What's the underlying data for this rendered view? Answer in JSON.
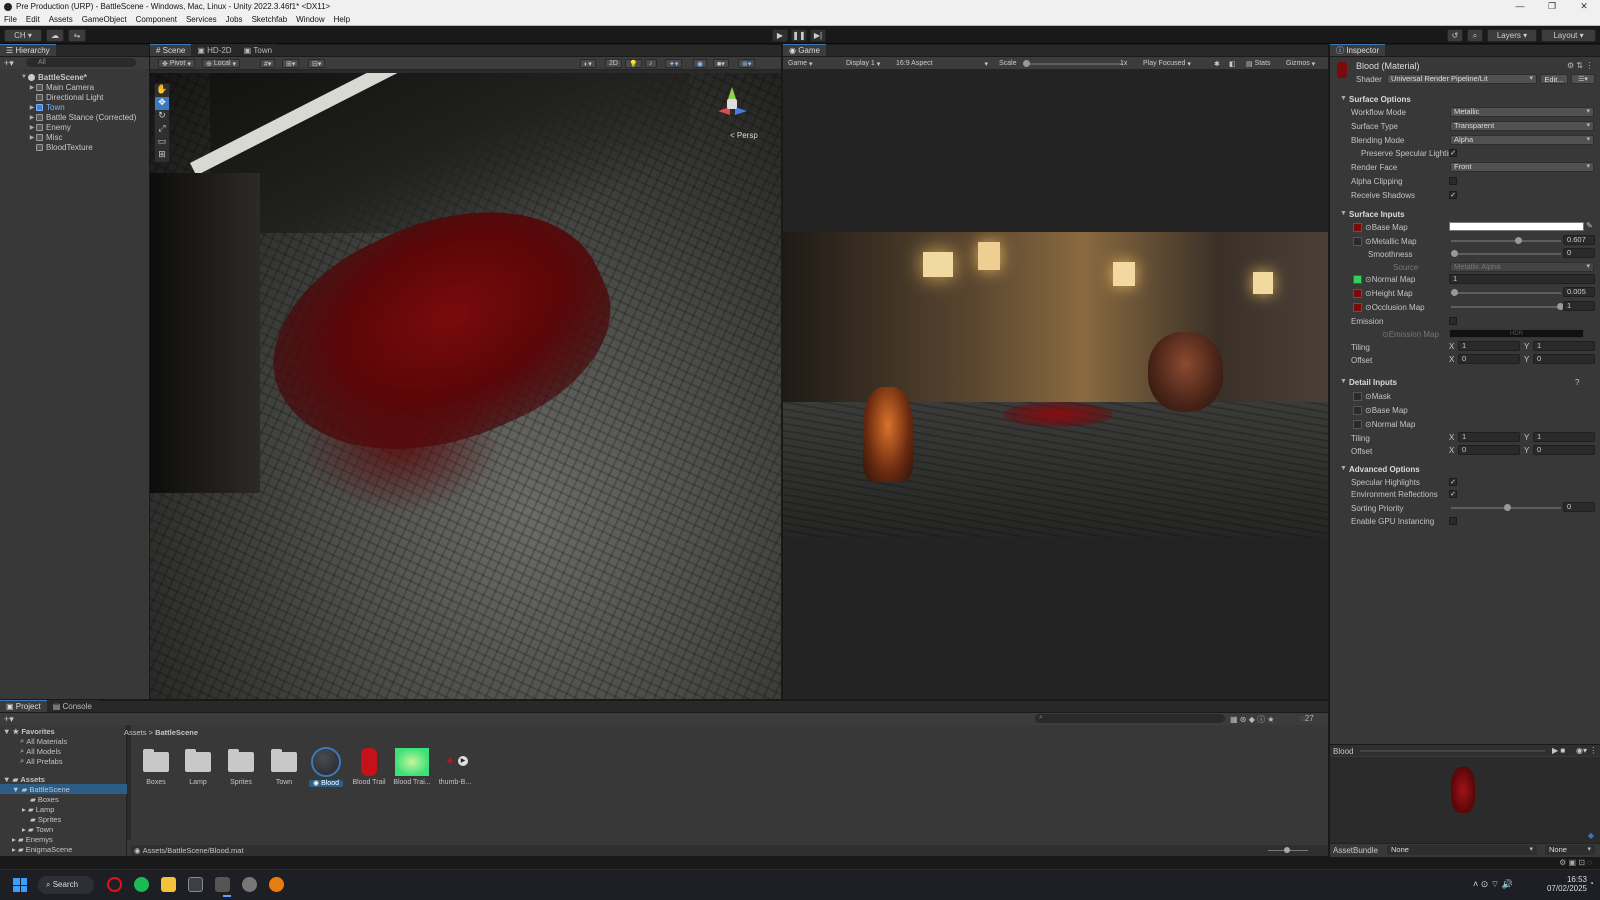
{
  "window": {
    "title": "Pre Production (URP) - BattleScene - Windows, Mac, Linux - Unity 2022.3.46f1* <DX11>",
    "controls": [
      "—",
      "❐",
      "✕"
    ]
  },
  "menu": [
    "File",
    "Edit",
    "Assets",
    "GameObject",
    "Component",
    "Services",
    "Jobs",
    "Sketchfab",
    "Window",
    "Help"
  ],
  "toolbar": {
    "account": "CH",
    "layers": "Layers",
    "layout": "Layout"
  },
  "hierarchy": {
    "tab": "Hierarchy",
    "search_placeholder": "All",
    "scene": "BattleScene*",
    "items": [
      "Main Camera",
      "Directional Light",
      "Town",
      "Battle Stance (Corrected)",
      "Enemy",
      "Misc",
      "BloodTexture"
    ]
  },
  "scene_view": {
    "tabs": [
      "Scene",
      "HD-2D",
      "Town"
    ],
    "pivot": "Pivot",
    "local": "Local",
    "mode_2d": "2D",
    "persp": "< Persp"
  },
  "game_view": {
    "tab": "Game",
    "mode": "Game",
    "display": "Display 1",
    "aspect": "16:9 Aspect",
    "scale_label": "Scale",
    "scale_value": "1x",
    "play_focused": "Play Focused",
    "stats": "Stats",
    "gizmos": "Gizmos"
  },
  "inspector": {
    "tab": "Inspector",
    "material_name": "Blood (Material)",
    "shader_label": "Shader",
    "shader_value": "Universal Render Pipeline/Lit",
    "edit_button": "Edit...",
    "surface_options": {
      "header": "Surface Options",
      "workflow_mode_label": "Workflow Mode",
      "workflow_mode": "Metallic",
      "surface_type_label": "Surface Type",
      "surface_type": "Transparent",
      "blending_mode_label": "Blending Mode",
      "blending_mode": "Alpha",
      "preserve_specular_label": "Preserve Specular Lightir",
      "render_face_label": "Render Face",
      "render_face": "Front",
      "alpha_clipping_label": "Alpha Clipping",
      "receive_shadows_label": "Receive Shadows"
    },
    "surface_inputs": {
      "header": "Surface Inputs",
      "base_map": "Base Map",
      "metallic_map": "Metallic Map",
      "metallic_value": "0.607",
      "metallic_fraction": 0.607,
      "smoothness": "Smoothness",
      "smoothness_value": "0",
      "smoothness_fraction": 0,
      "source": "Source",
      "source_value": "Metallic Alpha",
      "normal_map": "Normal Map",
      "normal_value": "1",
      "height_map": "Height Map",
      "height_value": "0.005",
      "height_fraction": 0.0,
      "occlusion_map": "Occlusion Map",
      "occlusion_value": "1",
      "occlusion_fraction": 1,
      "emission": "Emission",
      "emission_map": "Emission Map",
      "hdr": "HDR",
      "tiling": "Tiling",
      "offset": "Offset",
      "tiling_x": "1",
      "tiling_y": "1",
      "offset_x": "0",
      "offset_y": "0"
    },
    "detail_inputs": {
      "header": "Detail Inputs",
      "mask": "Mask",
      "base_map": "Base Map",
      "normal_map": "Normal Map",
      "tiling": "Tiling",
      "offset": "Offset",
      "tiling_x": "1",
      "tiling_y": "1",
      "offset_x": "0",
      "offset_y": "0"
    },
    "advanced_options": {
      "header": "Advanced Options",
      "specular_highlights": "Specular Highlights",
      "environment_reflections": "Environment Reflections",
      "sorting_priority": "Sorting Priority",
      "sorting_value": "0",
      "sorting_fraction": 0.5,
      "gpu_instancing": "Enable GPU Instancing"
    },
    "axis_x": "X",
    "axis_y": "Y",
    "preview": {
      "name": "Blood"
    },
    "assetbundle": {
      "label": "AssetBundle",
      "value": "None",
      "variant": "None"
    }
  },
  "project": {
    "tabs": [
      "Project",
      "Console"
    ],
    "count": "27",
    "favorites": {
      "header": "Favorites",
      "items": [
        "All Materials",
        "All Models",
        "All Prefabs"
      ]
    },
    "assets": {
      "header": "Assets",
      "battlescene": "BattleScene",
      "children": [
        "Boxes",
        "Lamp",
        "Sprites",
        "Town"
      ],
      "siblings": [
        "Enemys",
        "EnigmaScene"
      ]
    },
    "breadcrumb": [
      "Assets",
      "BattleScene"
    ],
    "grid": [
      "Boxes",
      "Lamp",
      "Sprites",
      "Town",
      "Blood",
      "Blood Trail",
      "Blood Trai...",
      "thumb-B..."
    ],
    "path": "Assets/BattleScene/Blood.mat"
  },
  "taskbar": {
    "search": "Search",
    "time": "16:53",
    "date": "07/02/2025"
  },
  "colors": {
    "accent": "#3a79bb",
    "panel": "#383838",
    "blood": "#7a0a0c",
    "normal_map_green": "#2fd15a"
  }
}
